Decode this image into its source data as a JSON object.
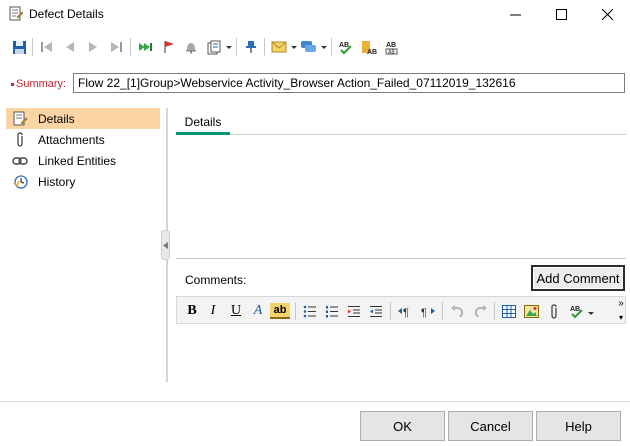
{
  "window": {
    "title": "Defect Details"
  },
  "toolbar": {
    "icons": [
      "save-icon",
      "first-record-icon",
      "previous-record-icon",
      "next-record-icon",
      "last-record-icon",
      "go-to-icon",
      "flag-icon",
      "alert-icon",
      "copy-url-icon",
      "pin-icon",
      "send-email-icon",
      "send-message-icon",
      "spell-check-icon",
      "spelling-options-icon",
      "thesaurus-icon"
    ]
  },
  "summary": {
    "label": "Summary:",
    "value": "Flow 22_[1]Group>Webservice Activity_Browser Action_Failed_07112019_132616"
  },
  "nav": {
    "items": [
      {
        "label": "Details",
        "icon": "details-icon",
        "active": true
      },
      {
        "label": "Attachments",
        "icon": "paperclip-icon",
        "active": false
      },
      {
        "label": "Linked Entities",
        "icon": "link-icon",
        "active": false
      },
      {
        "label": "History",
        "icon": "history-icon",
        "active": false
      }
    ]
  },
  "tabs": {
    "details_label": "Details"
  },
  "comments": {
    "label": "Comments:",
    "add_button": "Add Comment"
  },
  "editor": {
    "bold": "B",
    "italic": "I",
    "underline": "U",
    "font_color": "A",
    "highlight": "ab"
  },
  "footer": {
    "ok": "OK",
    "cancel": "Cancel",
    "help": "Help"
  },
  "colors": {
    "accent": "#0b9377",
    "required": "#c0272d",
    "nav_active": "#fbd5a4"
  }
}
